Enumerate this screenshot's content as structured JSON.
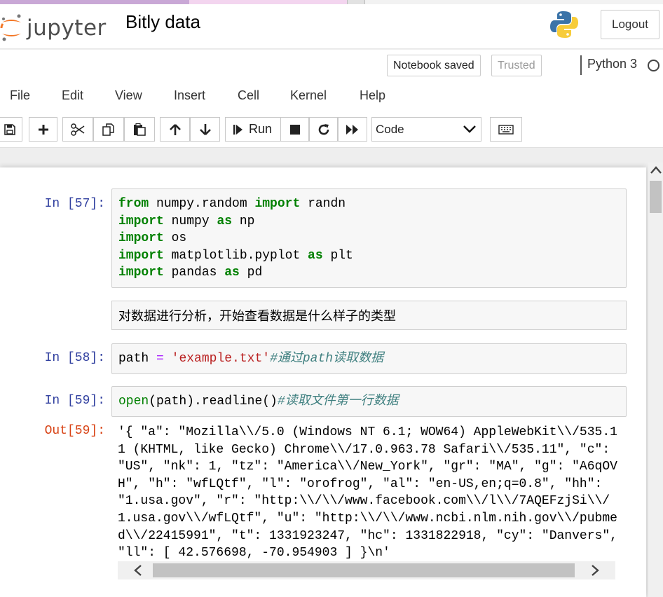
{
  "header": {
    "logo_text": "jupyter",
    "notebook_title": "Bitly data",
    "logout_label": "Logout",
    "python_logo_icon": "python-logo-icon"
  },
  "status": {
    "notebook_saved": "Notebook saved",
    "trusted": "Trusted",
    "kernel_name": "Python 3"
  },
  "menu": [
    "File",
    "Edit",
    "View",
    "Insert",
    "Cell",
    "Kernel",
    "Help"
  ],
  "toolbar": {
    "run_label": "Run",
    "cell_type": "Code",
    "icons": [
      "save-icon",
      "plus-icon",
      "cut-icon",
      "copy-icon",
      "paste-icon",
      "arrow-up-icon",
      "arrow-down-icon",
      "step-forward-icon",
      "stop-icon",
      "restart-icon",
      "fast-forward-icon",
      "keyboard-icon"
    ]
  },
  "cells": {
    "c57": {
      "prompt": "In [57]:",
      "lines": [
        [
          [
            "kw",
            "from"
          ],
          [
            "t",
            " numpy.random "
          ],
          [
            "kw",
            "import"
          ],
          [
            "t",
            " randn"
          ]
        ],
        [
          [
            "kw",
            "import"
          ],
          [
            "t",
            " numpy "
          ],
          [
            "kw",
            "as"
          ],
          [
            "t",
            " np"
          ]
        ],
        [
          [
            "kw",
            "import"
          ],
          [
            "t",
            " os"
          ]
        ],
        [
          [
            "kw",
            "import"
          ],
          [
            "t",
            " matplotlib.pyplot "
          ],
          [
            "kw",
            "as"
          ],
          [
            "t",
            " plt"
          ]
        ],
        [
          [
            "kw",
            "import"
          ],
          [
            "t",
            " pandas "
          ],
          [
            "kw",
            "as"
          ],
          [
            "t",
            " pd"
          ]
        ]
      ]
    },
    "md1": {
      "text": "对数据进行分析，开始查看数据是什么样子的类型"
    },
    "c58": {
      "prompt": "In [58]:",
      "lines": [
        [
          [
            "t",
            "path "
          ],
          [
            "op",
            "="
          ],
          [
            "t",
            " "
          ],
          [
            "str",
            "'example.txt'"
          ],
          [
            "cmt",
            "#通过path读取数据"
          ]
        ]
      ]
    },
    "c59": {
      "prompt": "In [59]:",
      "lines": [
        [
          [
            "fn",
            "open"
          ],
          [
            "t",
            "(path).readline()"
          ],
          [
            "cmt",
            "#读取文件第一行数据"
          ]
        ]
      ],
      "out_prompt": "Out[59]:",
      "output": "'{ \"a\": \"Mozilla\\\\/5.0 (Windows NT 6.1; WOW64) AppleWebKit\\\\/535.11 (KHTML, like Gecko) Chrome\\\\/17.0.963.78 Safari\\\\/535.11\", \"c\": \"US\", \"nk\": 1, \"tz\": \"America\\\\/New_York\", \"gr\": \"MA\", \"g\": \"A6qOVH\", \"h\": \"wfLQtf\", \"l\": \"orofrog\", \"al\": \"en-US,en;q=0.8\", \"hh\": \"1.usa.gov\", \"r\": \"http:\\\\/\\\\/www.facebook.com\\\\/l\\\\/7AQEFzjSi\\\\/1.usa.gov\\\\/wfLQtf\", \"u\": \"http:\\\\/\\\\/www.ncbi.nlm.nih.gov\\\\/pubmed\\\\/22415991\", \"t\": 1331923247, \"hc\": 1331822918, \"cy\": \"Danvers\", \"ll\": [ 42.576698, -70.954903 ] }\\n'"
    }
  }
}
